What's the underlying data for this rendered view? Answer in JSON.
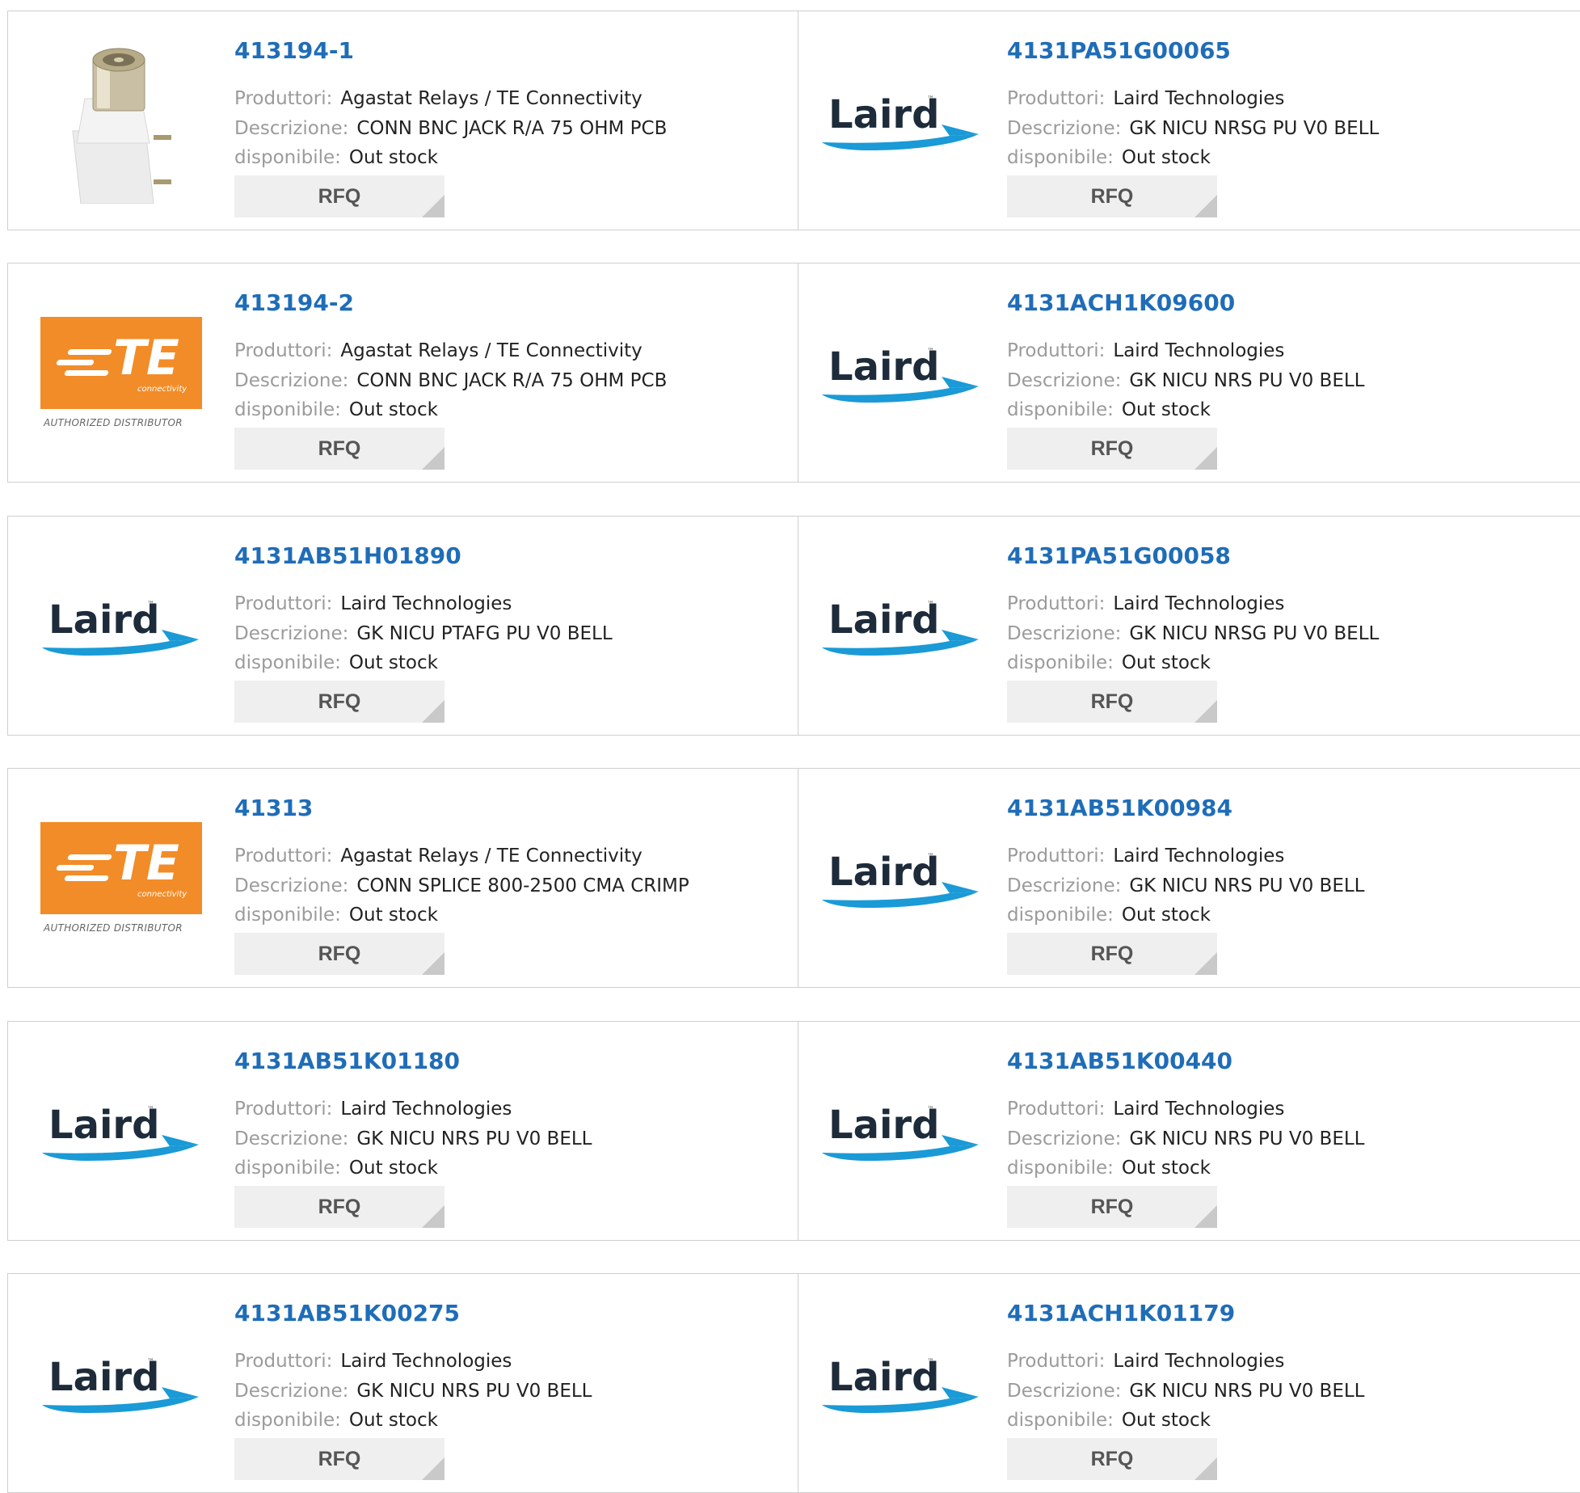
{
  "labels": {
    "manufacturer": "Produttori:",
    "description": "Descrizione:",
    "availability": "disponibile:",
    "rfq": "RFQ"
  },
  "logos": {
    "laird_text": "Laird",
    "laird_tm": "™",
    "te_letters": "TE",
    "te_sub": "connectivity",
    "te_authorized": "AUTHORIZED DISTRIBUTOR"
  },
  "colors": {
    "part_link": "#1f6db8",
    "label_gray": "#9b9b9b",
    "rfq_bg": "#efefef",
    "te_orange": "#f28c28",
    "laird_blue": "#1a9ad6"
  },
  "products": [
    {
      "part": "413194-1",
      "manufacturer": "Agastat Relays / TE Connectivity",
      "description": "CONN BNC JACK R/A 75 OHM PCB",
      "availability": "Out stock",
      "image": "bnc-connector"
    },
    {
      "part": "4131PA51G00065",
      "manufacturer": "Laird Technologies",
      "description": "GK NICU NRSG PU V0 BELL",
      "availability": "Out stock",
      "image": "laird-logo"
    },
    {
      "part": "413194-2",
      "manufacturer": "Agastat Relays / TE Connectivity",
      "description": "CONN BNC JACK R/A 75 OHM PCB",
      "availability": "Out stock",
      "image": "te-logo"
    },
    {
      "part": "4131ACH1K09600",
      "manufacturer": "Laird Technologies",
      "description": "GK NICU NRS PU V0 BELL",
      "availability": "Out stock",
      "image": "laird-logo"
    },
    {
      "part": "4131AB51H01890",
      "manufacturer": "Laird Technologies",
      "description": "GK NICU PTAFG PU V0 BELL",
      "availability": "Out stock",
      "image": "laird-logo"
    },
    {
      "part": "4131PA51G00058",
      "manufacturer": "Laird Technologies",
      "description": "GK NICU NRSG PU V0 BELL",
      "availability": "Out stock",
      "image": "laird-logo"
    },
    {
      "part": "41313",
      "manufacturer": "Agastat Relays / TE Connectivity",
      "description": "CONN SPLICE 800-2500 CMA CRIMP",
      "availability": "Out stock",
      "image": "te-logo"
    },
    {
      "part": "4131AB51K00984",
      "manufacturer": "Laird Technologies",
      "description": "GK NICU NRS PU V0 BELL",
      "availability": "Out stock",
      "image": "laird-logo"
    },
    {
      "part": "4131AB51K01180",
      "manufacturer": "Laird Technologies",
      "description": "GK NICU NRS PU V0 BELL",
      "availability": "Out stock",
      "image": "laird-logo"
    },
    {
      "part": "4131AB51K00440",
      "manufacturer": "Laird Technologies",
      "description": "GK NICU NRS PU V0 BELL",
      "availability": "Out stock",
      "image": "laird-logo"
    },
    {
      "part": "4131AB51K00275",
      "manufacturer": "Laird Technologies",
      "description": "GK NICU NRS PU V0 BELL",
      "availability": "Out stock",
      "image": "laird-logo"
    },
    {
      "part": "4131ACH1K01179",
      "manufacturer": "Laird Technologies",
      "description": "GK NICU NRS PU V0 BELL",
      "availability": "Out stock",
      "image": "laird-logo"
    }
  ]
}
